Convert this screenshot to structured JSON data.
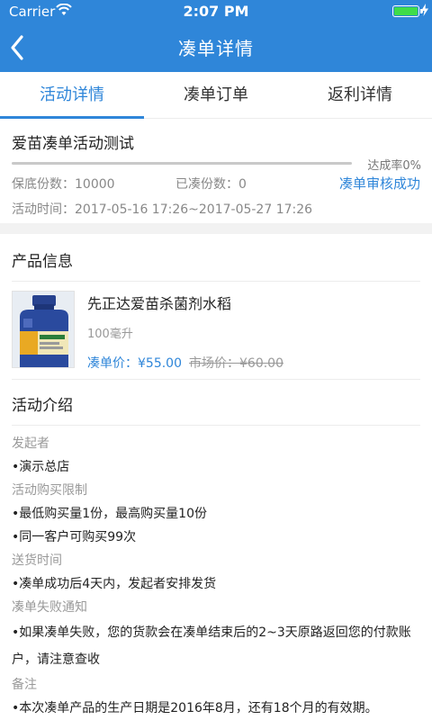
{
  "status_bar": {
    "carrier": "Carrier",
    "time": "2:07 PM"
  },
  "nav": {
    "title": "凑单详情"
  },
  "tabs": [
    {
      "label": "活动详情",
      "active": true
    },
    {
      "label": "凑单订单",
      "active": false
    },
    {
      "label": "返利详情",
      "active": false
    }
  ],
  "activity": {
    "name": "爱苗凑单活动测试",
    "progress_fraction": 0.0,
    "rate_label": "达成率",
    "rate_value": "0%",
    "quota_label": "保底份数：",
    "quota_value": "10000",
    "joined_label": "已凑份数：",
    "joined_value": "0",
    "status": "凑单审核成功",
    "time_label": "活动时间：",
    "time_value": "2017-05-16 17:26~2017-05-27 17:26"
  },
  "product": {
    "section_title": "产品信息",
    "name": "先正达爱苗杀菌剂水稻",
    "spec": "100毫升",
    "price_label": "凑单价：",
    "price_value": "¥55.00",
    "market_label": "市场价：",
    "market_value": "¥60.00"
  },
  "intro": {
    "title": "活动介绍",
    "sections": [
      {
        "label": "发起者",
        "items": [
          "•演示总店"
        ]
      },
      {
        "label": "活动购买限制",
        "items": [
          "•最低购买量1份，最高购买量10份",
          "•同一客户可购买99次"
        ]
      },
      {
        "label": "送货时间",
        "items": [
          "•凑单成功后4天内，发起者安排发货"
        ]
      },
      {
        "label": "凑单失败通知",
        "items": [
          "•如果凑单失败，您的货款会在凑单结束后的2~3天原路返回您的付款账户，请注意查收"
        ]
      },
      {
        "label": "备注",
        "items": [
          "•本次凑单产品的生产日期是2016年8月，还有18个月的有效期。"
        ]
      }
    ]
  },
  "colors": {
    "primary": "#2f86d9",
    "battery": "#3fdc4a"
  },
  "icons": [
    "wifi-icon",
    "battery-icon",
    "charging-bolt-icon",
    "back-arrow-icon"
  ]
}
